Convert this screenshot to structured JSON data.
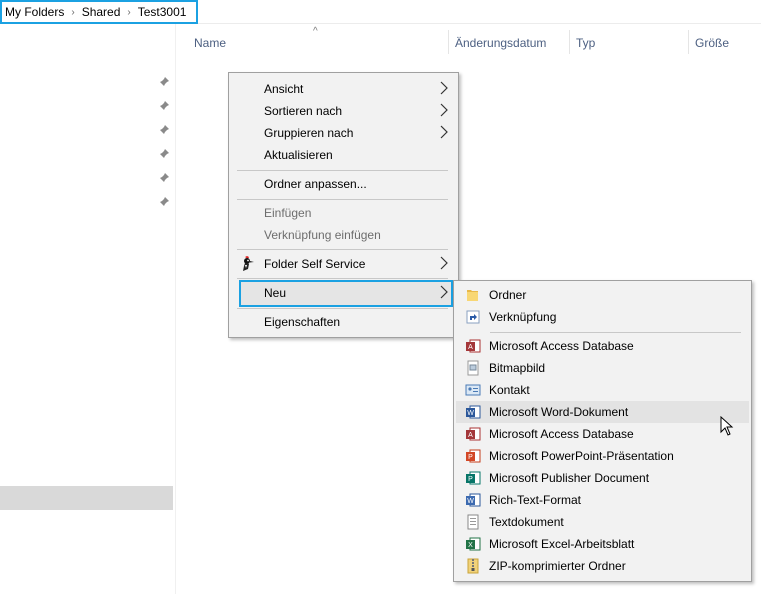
{
  "breadcrumb": {
    "items": [
      "My Folders",
      "Shared",
      "Test3001"
    ],
    "separator": "›"
  },
  "columns": {
    "name": "Name",
    "modified": "Änderungsdatum",
    "type": "Typ",
    "size": "Größe"
  },
  "context_menu": {
    "items": [
      {
        "label": "Ansicht",
        "submenu": true
      },
      {
        "label": "Sortieren nach",
        "submenu": true
      },
      {
        "label": "Gruppieren nach",
        "submenu": true
      },
      {
        "label": "Aktualisieren"
      },
      {
        "label": "Ordner anpassen..."
      },
      {
        "label": "Einfügen",
        "disabled": true
      },
      {
        "label": "Verknüpfung einfügen",
        "disabled": true
      },
      {
        "label": "Folder Self Service",
        "submenu": true,
        "icon": "woodpecker-icon"
      },
      {
        "label": "Neu",
        "submenu": true,
        "highlighted": true
      },
      {
        "label": "Eigenschaften"
      }
    ]
  },
  "new_submenu": {
    "items": [
      {
        "label": "Ordner",
        "icon": "folder-icon"
      },
      {
        "label": "Verknüpfung",
        "icon": "shortcut-icon"
      },
      {
        "label": "Microsoft Access Database",
        "icon": "access-icon"
      },
      {
        "label": "Bitmapbild",
        "icon": "bitmap-icon"
      },
      {
        "label": "Kontakt",
        "icon": "contact-icon"
      },
      {
        "label": "Microsoft Word-Dokument",
        "icon": "word-icon",
        "hovered": true
      },
      {
        "label": "Microsoft Access Database",
        "icon": "access-icon"
      },
      {
        "label": "Microsoft PowerPoint-Präsentation",
        "icon": "powerpoint-icon"
      },
      {
        "label": "Microsoft Publisher Document",
        "icon": "publisher-icon"
      },
      {
        "label": "Rich-Text-Format",
        "icon": "rtf-icon"
      },
      {
        "label": "Textdokument",
        "icon": "text-document-icon"
      },
      {
        "label": "Microsoft Excel-Arbeitsblatt",
        "icon": "excel-icon"
      },
      {
        "label": "ZIP-komprimierter Ordner",
        "icon": "zip-folder-icon"
      }
    ]
  },
  "colors": {
    "highlight_border": "#1ba1e2",
    "menu_background": "#f2f2f2",
    "column_header_text": "#4d6082"
  }
}
